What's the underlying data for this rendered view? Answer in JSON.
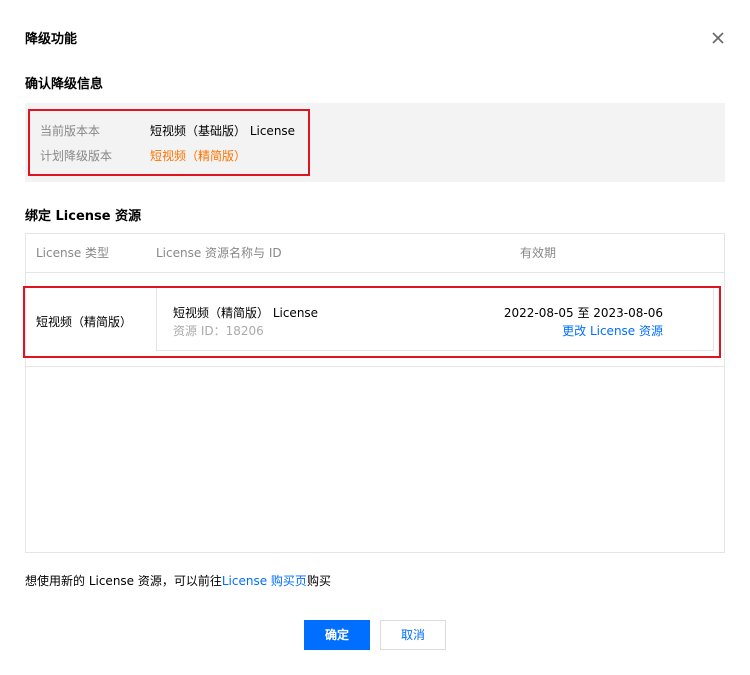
{
  "dialog": {
    "title": "降级功能"
  },
  "confirm_section": {
    "title": "确认降级信息",
    "current_version_label": "当前版本本",
    "current_version_value": "短视频（基础版） License",
    "planned_version_label": "计划降级版本",
    "planned_version_value": "短视频（精简版）"
  },
  "bind_section": {
    "title": "绑定 License 资源",
    "columns": [
      "License 类型",
      "License 资源名称与 ID",
      "有效期"
    ],
    "row": {
      "license_type": "短视频（精简版）",
      "resource_name": "短视频（精简版） License",
      "resource_id": "资源 ID：18206",
      "validity": "2022-08-05 至 2023-08-06",
      "change_link": "更改 License 资源"
    }
  },
  "footer_note": {
    "prefix": "想使用新的 License 资源，可以前往",
    "link": "License 购买页",
    "suffix": "购买"
  },
  "buttons": {
    "confirm": "确定",
    "cancel": "取消"
  },
  "colors": {
    "primary": "#006eff",
    "highlight": "#ff7200",
    "annotation_box": "#e0141e"
  }
}
